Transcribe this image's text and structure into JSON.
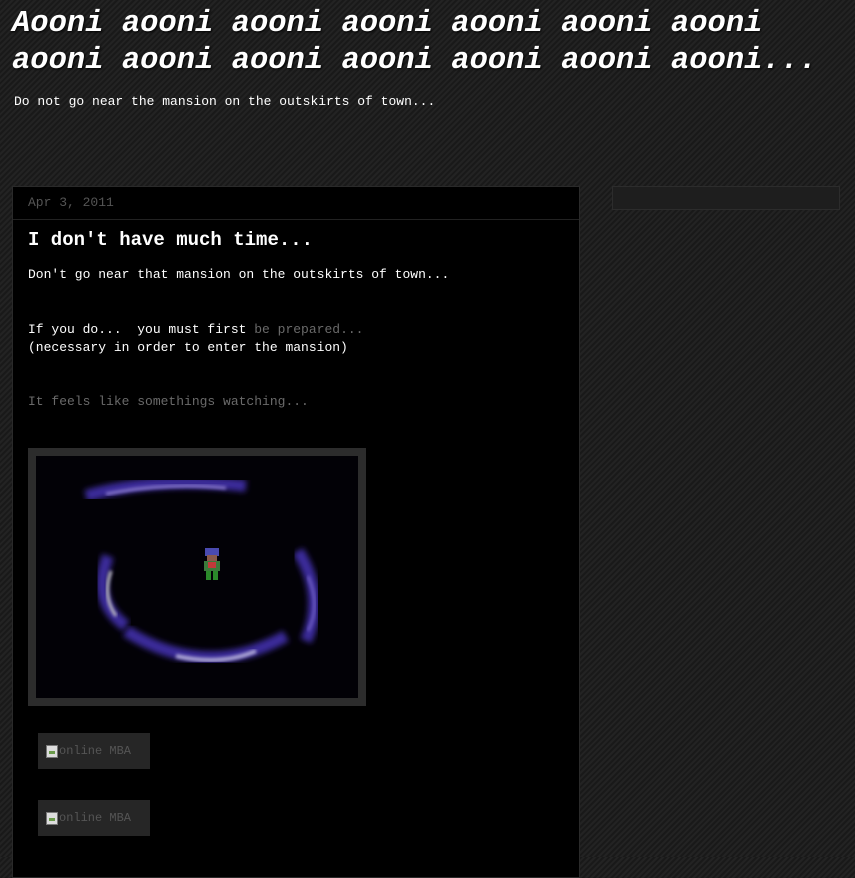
{
  "header": {
    "title": "Aooni aooni aooni aooni aooni aooni aooni aooni aooni aooni aooni aooni aooni aooni...",
    "description": "Do not go near the mansion on the outskirts of town..."
  },
  "post": {
    "date": "Apr 3, 2011",
    "title": "I don't have much time...",
    "line1": "Don't go near that mansion on the outskirts of town...",
    "line2_prefix": "If you do...  you must first ",
    "line2_link": "be prepared...",
    "line3": "(necessary in order to enter the mansion)",
    "line4": "It feels like somethings watching...",
    "image_alt_1": "online MBA",
    "image_alt_2": "online MBA"
  },
  "colors": {
    "background": "#1c1c1c",
    "post_background": "#000000",
    "text": "#ffffff",
    "dim_text": "#6a6a6a",
    "vortex": "#4a3aaa"
  },
  "icons": {
    "broken_image": "broken-image-icon"
  }
}
